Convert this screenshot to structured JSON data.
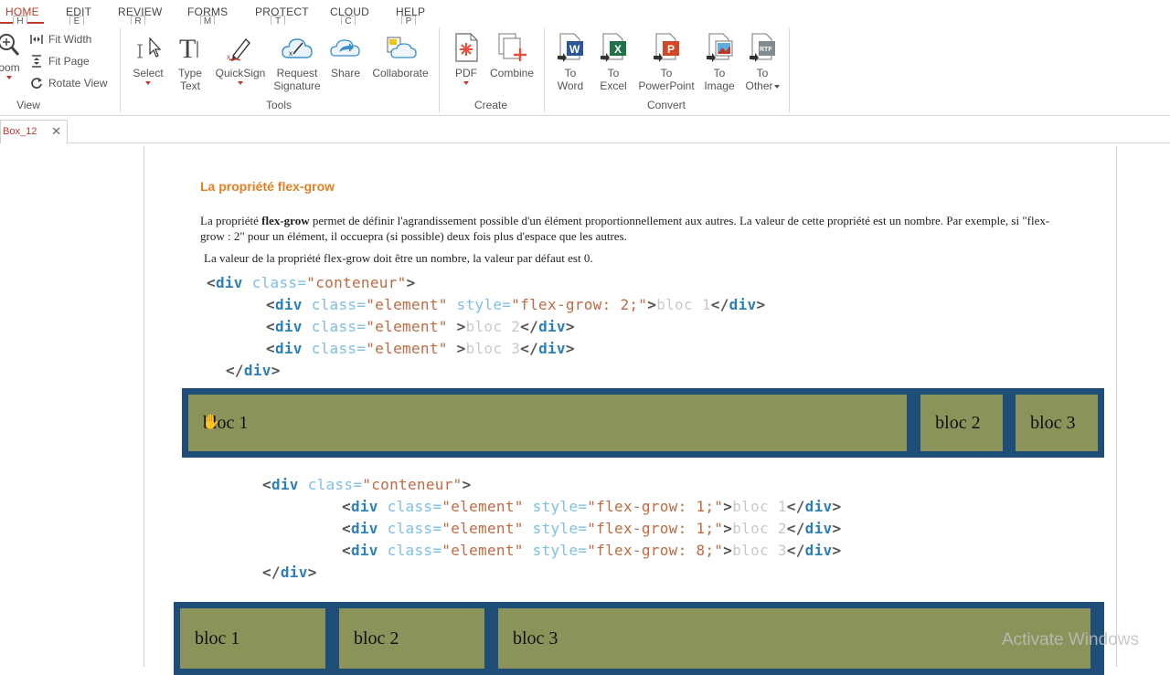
{
  "ribbon_tabs": [
    {
      "label": "HOME",
      "key": "H"
    },
    {
      "label": "EDIT",
      "key": "E"
    },
    {
      "label": "REVIEW",
      "key": "R"
    },
    {
      "label": "FORMS",
      "key": "M"
    },
    {
      "label": "PROTECT",
      "key": "T"
    },
    {
      "label": "CLOUD",
      "key": "C"
    },
    {
      "label": "HELP",
      "key": "P"
    }
  ],
  "view_group": {
    "zoom_label": "oom",
    "fit_width": "Fit Width",
    "fit_page": "Fit Page",
    "rotate_view": "Rotate View",
    "group_label": "View"
  },
  "tools_group": {
    "select": "Select",
    "type_text_1": "Type",
    "type_text_2": "Text",
    "quicksign": "QuickSign",
    "request_1": "Request",
    "request_2": "Signature",
    "share": "Share",
    "collaborate": "Collaborate",
    "group_label": "Tools"
  },
  "create_group": {
    "pdf": "PDF",
    "combine": "Combine",
    "group_label": "Create"
  },
  "convert_group": {
    "to_word_1": "To",
    "to_word_2": "Word",
    "to_excel_1": "To",
    "to_excel_2": "Excel",
    "to_ppt_1": "To",
    "to_ppt_2": "PowerPoint",
    "to_image_1": "To",
    "to_image_2": "Image",
    "to_other_1": "To",
    "to_other_2": "Other",
    "group_label": "Convert"
  },
  "document_tab": {
    "label": "Box_12",
    "close": "✕"
  },
  "page": {
    "title": "La propriété flex-grow",
    "para1_a": "La propriété ",
    "para1_bold": "flex-grow",
    "para1_b": " permet de définir l'agrandissement possible d'un élément proportionnellement aux autres. La valeur de cette propriété est un nombre. Par exemple, si \"flex-grow : 2\" pour un élément, il occuepra (si possible) deux fois plus d'espace que les autres.",
    "para2": "La valeur de la propriété flex-grow doit être un nombre, la valeur par défaut est 0.",
    "demo1": [
      "bloc 1",
      "bloc 2",
      "bloc 3"
    ],
    "demo2": [
      "bloc 1",
      "bloc 2",
      "bloc 3"
    ]
  },
  "watermark": "Activate Windows",
  "colors": {
    "accent": "#c0392b",
    "title": "#e67e22",
    "flex_border": "#1f4e79",
    "flex_item": "#8b935a"
  }
}
